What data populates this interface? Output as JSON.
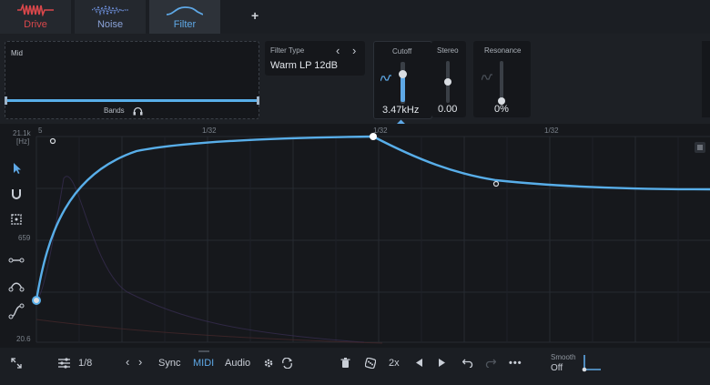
{
  "tabs": [
    {
      "label": "Drive",
      "icon": "drive-wave-icon",
      "color": "#d8474b"
    },
    {
      "label": "Noise",
      "icon": "noise-wave-icon",
      "color": "#6c8ed8"
    },
    {
      "label": "Filter",
      "icon": "filter-curve-icon",
      "color": "#5ea8e6"
    }
  ],
  "add_tab_symbol": "+",
  "bands": {
    "title": "Mid",
    "footer": "Bands",
    "icon": "headphones-icon"
  },
  "filter_type": {
    "label": "Filter Type",
    "value": "Warm LP 12dB",
    "prev": "‹",
    "next": "›"
  },
  "cutoff": {
    "label": "Cutoff",
    "value": "3.47kHz",
    "level": 0.72,
    "mod_icon": "lfo-wave-icon"
  },
  "stereo": {
    "label": "Stereo",
    "value": "0.00",
    "level": 0.5
  },
  "resonance": {
    "label": "Resonance",
    "value": "0%",
    "level": 0.0
  },
  "plot": {
    "y_labels": [
      "21.1k",
      "[Hz]",
      "659",
      "20.6"
    ],
    "x_labels": [
      "5",
      "1/32",
      "1/32",
      "1/32"
    ],
    "curve_color": "#58aee9",
    "tools": [
      "pointer-tool-icon",
      "magnet-tool-icon",
      "select-tool-icon",
      "line-tool-icon",
      "curve-tool-icon",
      "s-curve-tool-icon"
    ],
    "menu_icon": "menu-lines-icon"
  },
  "bottom": {
    "grid_value": "1/8",
    "sync": "Sync",
    "midi": "MIDI",
    "audio": "Audio",
    "multiplier": "2x",
    "more": "•••",
    "smooth_label": "Smooth",
    "smooth_value": "Off",
    "accent": "#5ea8e6"
  }
}
